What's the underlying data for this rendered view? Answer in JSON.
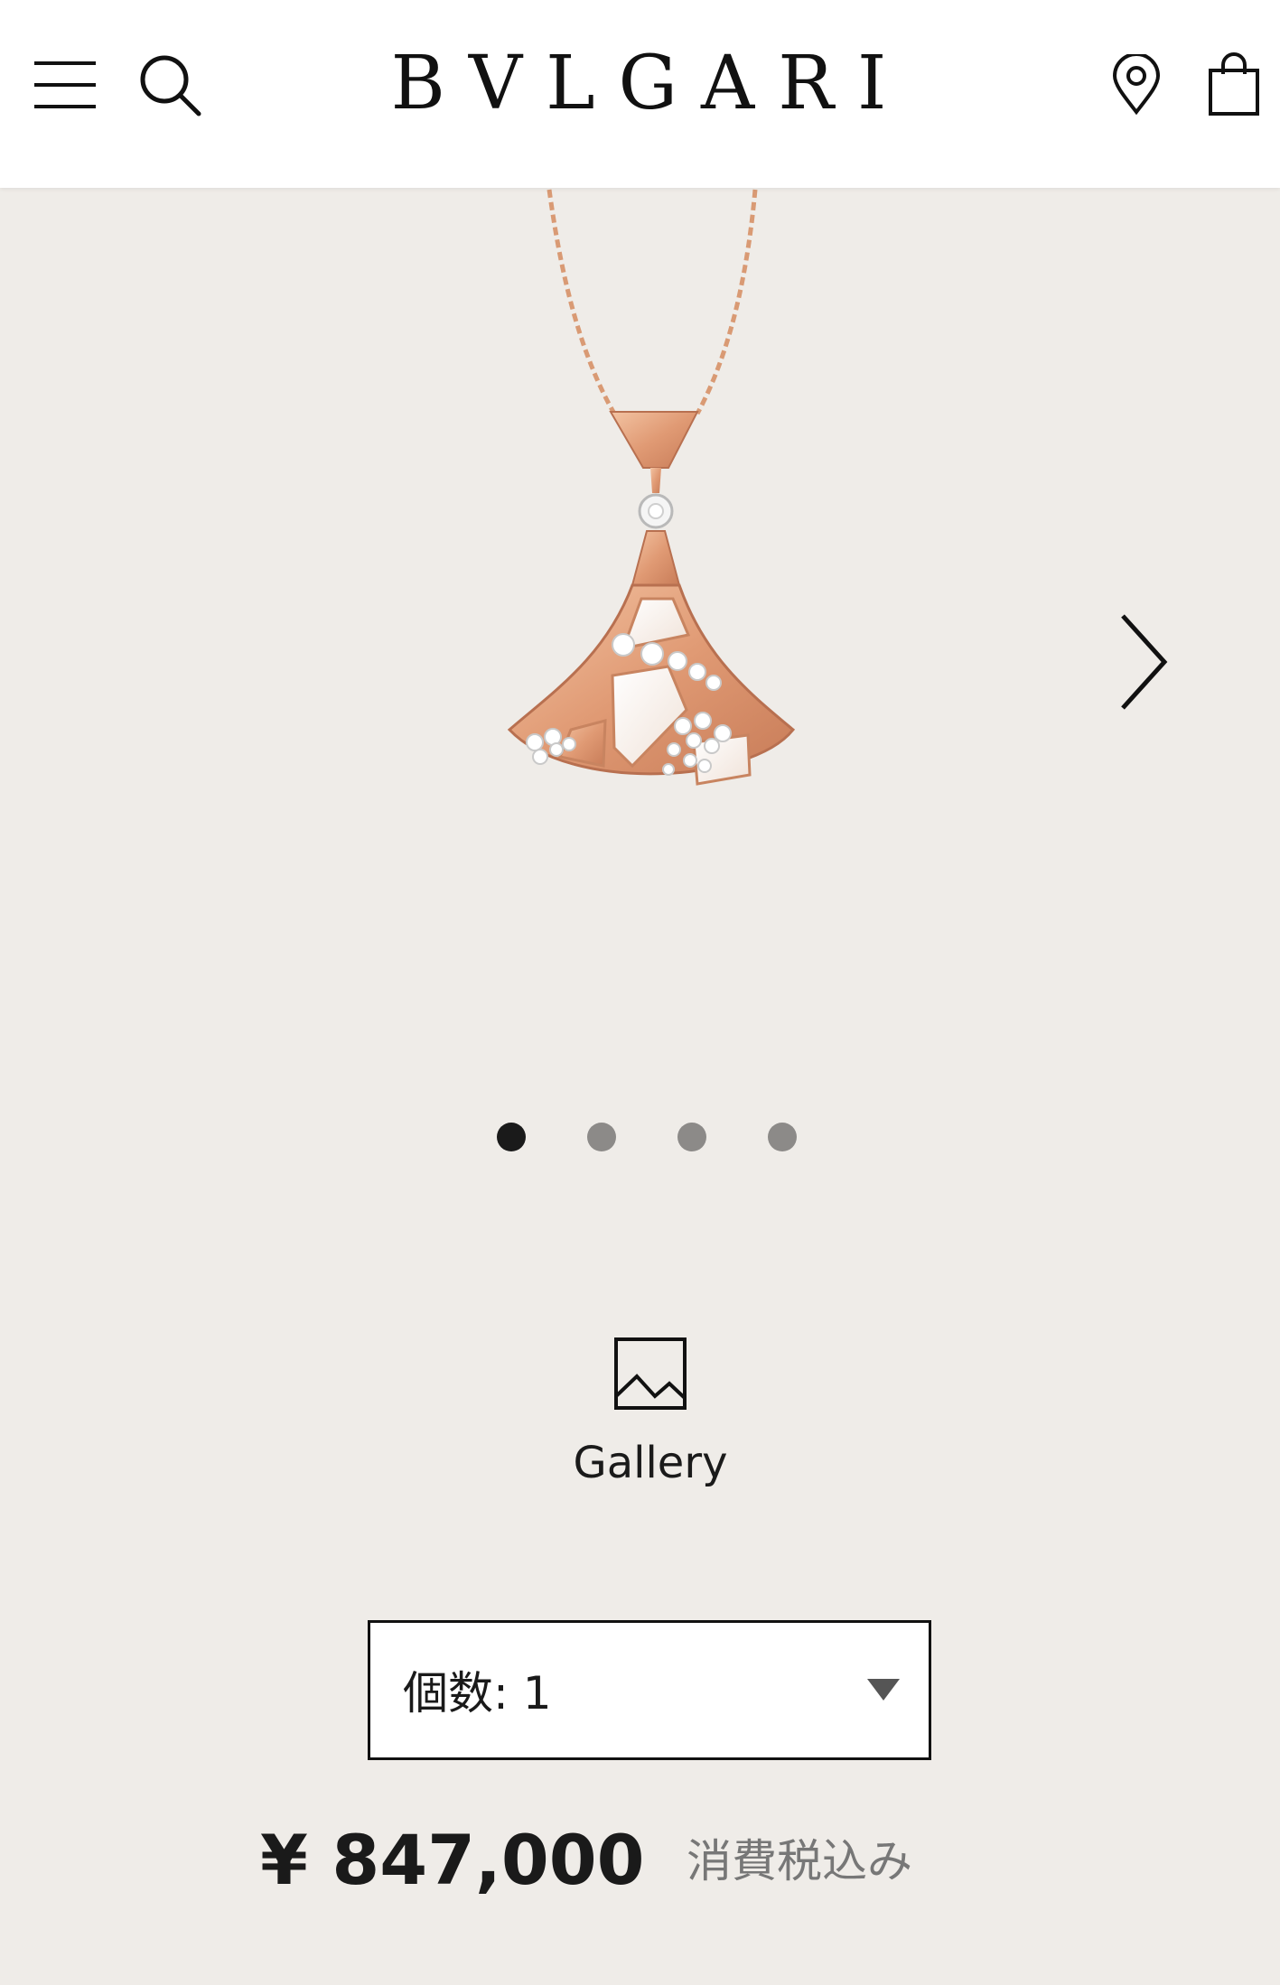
{
  "header": {
    "brand": "BVLGARI",
    "icons": [
      "menu-icon",
      "search-icon",
      "store-locator-icon",
      "shopping-bag-icon"
    ]
  },
  "carousel": {
    "slide_count": 4,
    "active_index": 0,
    "next_icon": "chevron-right-icon"
  },
  "gallery": {
    "icon": "image-icon",
    "label": "Gallery"
  },
  "quantity": {
    "label": "個数: 1",
    "selected": "1"
  },
  "price": {
    "amount": "¥ 847,000",
    "tax_note": "消費税込み"
  },
  "colors": {
    "page_bg": "#efece8",
    "rose_gold": "#e0a27f",
    "text": "#1a1a1a"
  }
}
